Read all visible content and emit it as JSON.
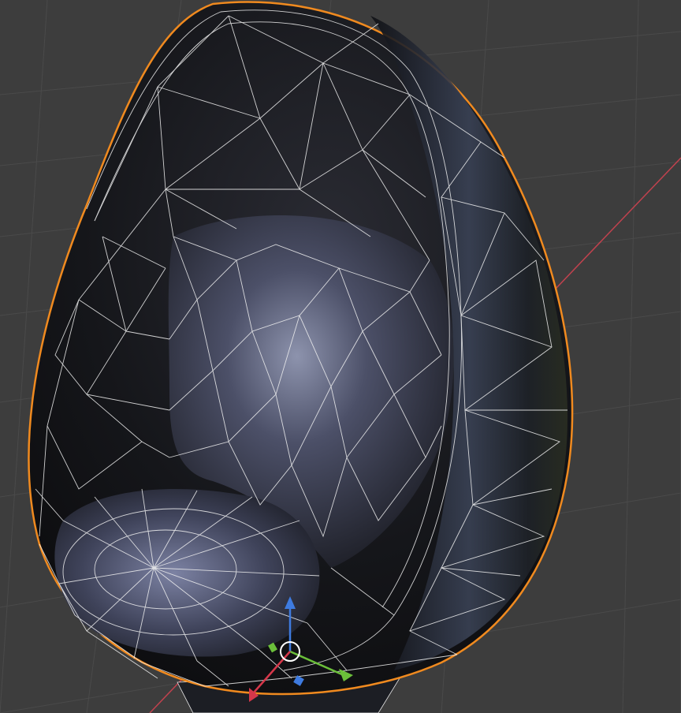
{
  "viewport": {
    "background": "#3d3d3d",
    "grid_color": "#4a4a4a",
    "x_axis_color": "#c0424e"
  },
  "object": {
    "type": "egg-chair",
    "shading": "solid",
    "overlay": "wireframe",
    "selected": true,
    "selection_outline_color": "#f08a1f",
    "wire_color": "#ffffff",
    "material_color": "#1a1a1e"
  },
  "gizmo": {
    "mode": "translate",
    "axes": [
      {
        "axis": "x",
        "color": "#d6374a"
      },
      {
        "axis": "y",
        "color": "#6bbf3a"
      },
      {
        "axis": "z",
        "color": "#3e7be0"
      }
    ]
  }
}
